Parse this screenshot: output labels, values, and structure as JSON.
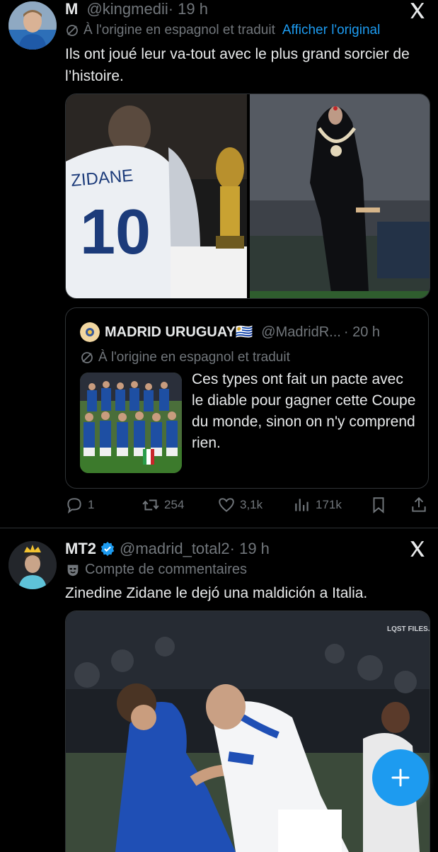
{
  "tweet1": {
    "display_name": "M",
    "handle": "@kingmedii",
    "time": "· 19 h",
    "translation_note": "À l'origine en espagnol et traduit",
    "show_original": "Afficher l'original",
    "text": "Ils ont joué leur va-tout avec le plus grand sorcier de l’histoire.",
    "jersey_name": "ZIDANE",
    "jersey_number": "10",
    "quote": {
      "display_name": "MADRID URUGUAY🇺🇾",
      "handle": "@MadridR...",
      "time": "· 20 h",
      "translation_note": "À l'origine en espagnol et traduit",
      "text": "Ces types ont fait un pacte avec le diable pour gagner cette Coupe du monde, sinon on n'y comprend rien."
    },
    "stats": {
      "replies": "1",
      "reposts": "254",
      "likes": "3,1k",
      "views": "171k"
    }
  },
  "tweet2": {
    "display_name": "MT2",
    "handle": "@madrid_total2",
    "time": "· 19 h",
    "label": "Compte de commentaires",
    "text": "Zinedine Zidane le dejó una maldición a Italia.",
    "watermark": "LQST FILES."
  },
  "colors": {
    "background": "#000000",
    "accent": "#1d9bf0",
    "muted": "#71767b",
    "verified": "#1d9bf0"
  }
}
